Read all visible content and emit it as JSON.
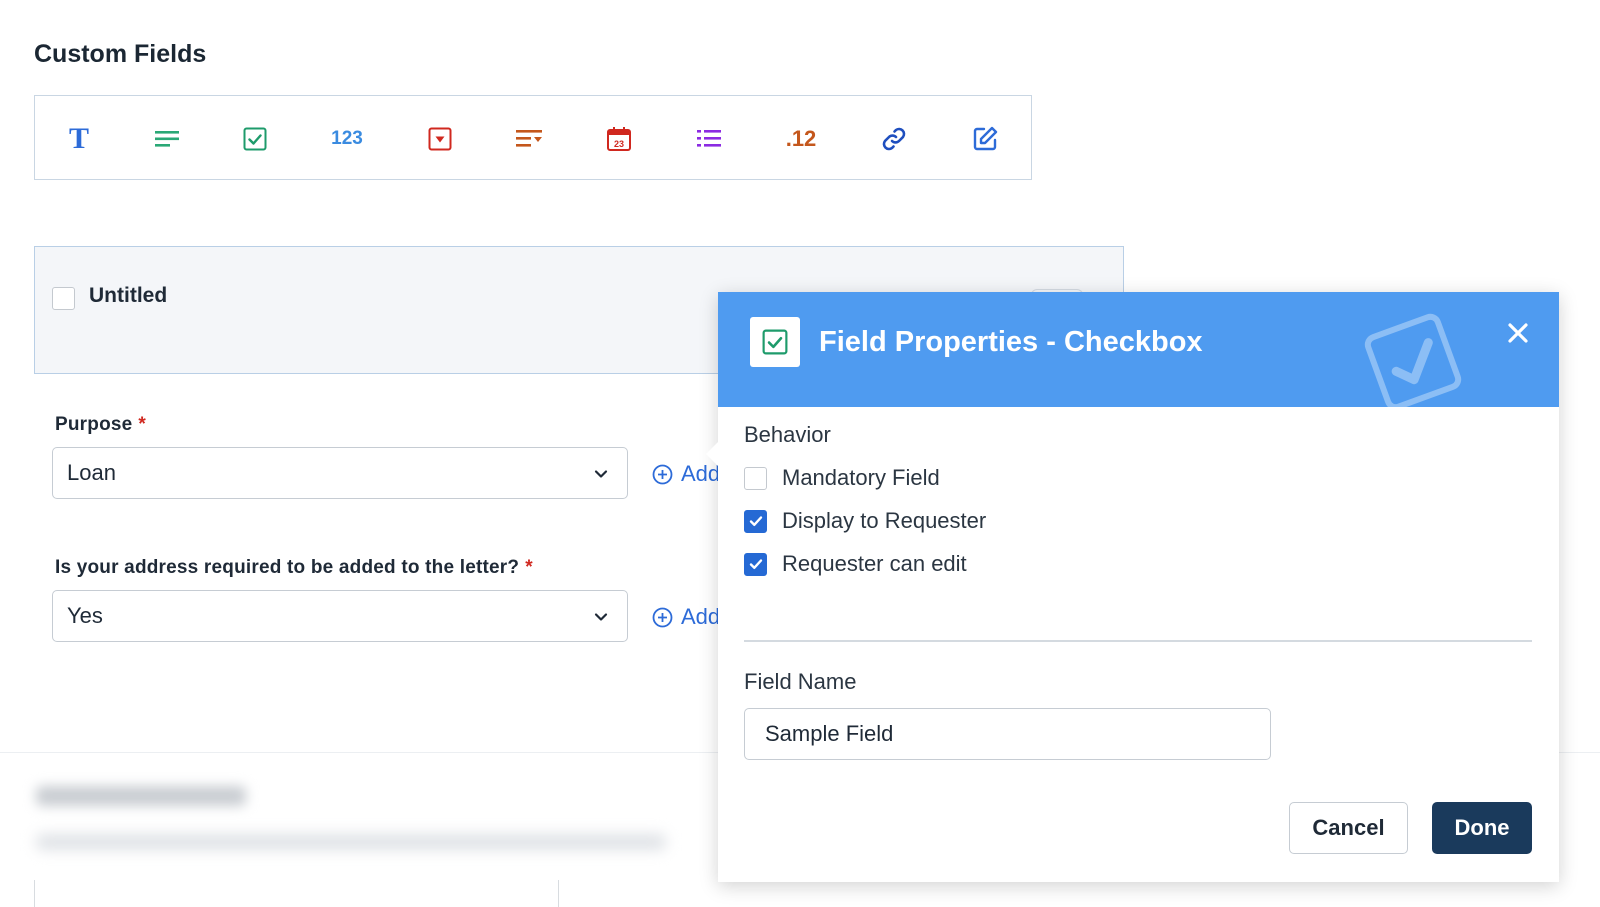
{
  "page": {
    "title": "Custom Fields"
  },
  "toolbar": {
    "items": [
      {
        "name": "text-field-icon",
        "glyph": "T",
        "color": "#2d6bd8"
      },
      {
        "name": "paragraph-field-icon",
        "color": "#2aa876"
      },
      {
        "name": "checkbox-field-icon",
        "color": "#1e9b6b"
      },
      {
        "name": "number-field-icon",
        "glyph": "123",
        "color": "#3a8be0"
      },
      {
        "name": "dropdown-field-icon",
        "color": "#d0281f"
      },
      {
        "name": "dependent-field-icon",
        "color": "#c4571c"
      },
      {
        "name": "date-field-icon",
        "glyph": "23",
        "color": "#d0281f"
      },
      {
        "name": "multiselect-field-icon",
        "color": "#8b2be2"
      },
      {
        "name": "decimal-field-icon",
        "glyph": ".12",
        "color": "#c4571c"
      },
      {
        "name": "url-field-icon",
        "color": "#1f4fbf"
      },
      {
        "name": "form-field-icon",
        "color": "#2d6bd8"
      }
    ]
  },
  "field_card": {
    "label": "Untitled"
  },
  "form": {
    "purpose": {
      "label": "Purpose",
      "required_mark": "*",
      "value": "Loan",
      "add_label": "Add"
    },
    "address": {
      "label": "Is your address required to be added to the letter?",
      "required_mark": "*",
      "value": "Yes",
      "add_label": "Add"
    }
  },
  "dialog": {
    "title": "Field Properties - Checkbox",
    "behavior_title": "Behavior",
    "options": [
      {
        "label": "Mandatory Field",
        "checked": false
      },
      {
        "label": "Display to Requester",
        "checked": true
      },
      {
        "label": "Requester can edit",
        "checked": true
      }
    ],
    "field_name_label": "Field Name",
    "field_name_value": "Sample Field",
    "cancel_label": "Cancel",
    "done_label": "Done",
    "colors": {
      "header": "#4f9bf0",
      "primary_button": "#1a3a5c",
      "checkbox_on": "#2569d4"
    }
  }
}
